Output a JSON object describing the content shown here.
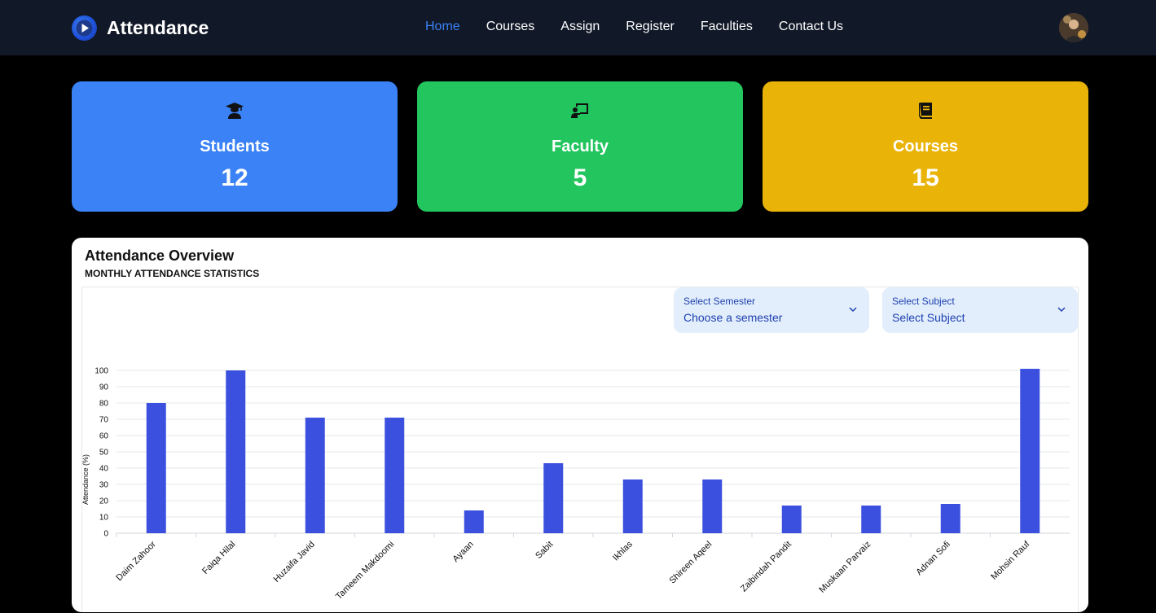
{
  "nav": {
    "brand": "Attendance",
    "links": [
      {
        "label": "Home",
        "active": true
      },
      {
        "label": "Courses",
        "active": false
      },
      {
        "label": "Assign",
        "active": false
      },
      {
        "label": "Register",
        "active": false
      },
      {
        "label": "Faculties",
        "active": false
      },
      {
        "label": "Contact Us",
        "active": false
      }
    ]
  },
  "stats": [
    {
      "label": "Students",
      "value": "12",
      "icon": "student-icon",
      "color": "#3b82f6"
    },
    {
      "label": "Faculty",
      "value": "5",
      "icon": "teacher-icon",
      "color": "#22c55e"
    },
    {
      "label": "Courses",
      "value": "15",
      "icon": "book-icon",
      "color": "#eab308"
    }
  ],
  "overview": {
    "title": "Attendance Overview",
    "subtitle": "MONTHLY ATTENDANCE STATISTICS",
    "semester": {
      "label": "Select Semester",
      "value": "Choose a semester"
    },
    "subject": {
      "label": "Select Subject",
      "value": "Select Subject"
    }
  },
  "chart_data": {
    "type": "bar",
    "categories": [
      "Daim Zahoor",
      "Faiqa Hilal",
      "Huzaifa Javid",
      "Tameem Makdoomi",
      "Ayaan",
      "Sabit",
      "Ikhlas",
      "Shireen Aqeel",
      "Zaibindah Pandit",
      "Muskaan Parvaiz",
      "Adnan Sofi",
      "Mohsin Rauf"
    ],
    "values": [
      80,
      100,
      71,
      71,
      14,
      43,
      33,
      33,
      17,
      17,
      18,
      101
    ],
    "ylabel": "Attendance (%)",
    "xlabel": "",
    "ylim": [
      0,
      100
    ],
    "yticks": [
      0,
      10,
      20,
      30,
      40,
      50,
      60,
      70,
      80,
      90,
      100
    ],
    "bar_color": "#3b50de",
    "grid": true
  }
}
